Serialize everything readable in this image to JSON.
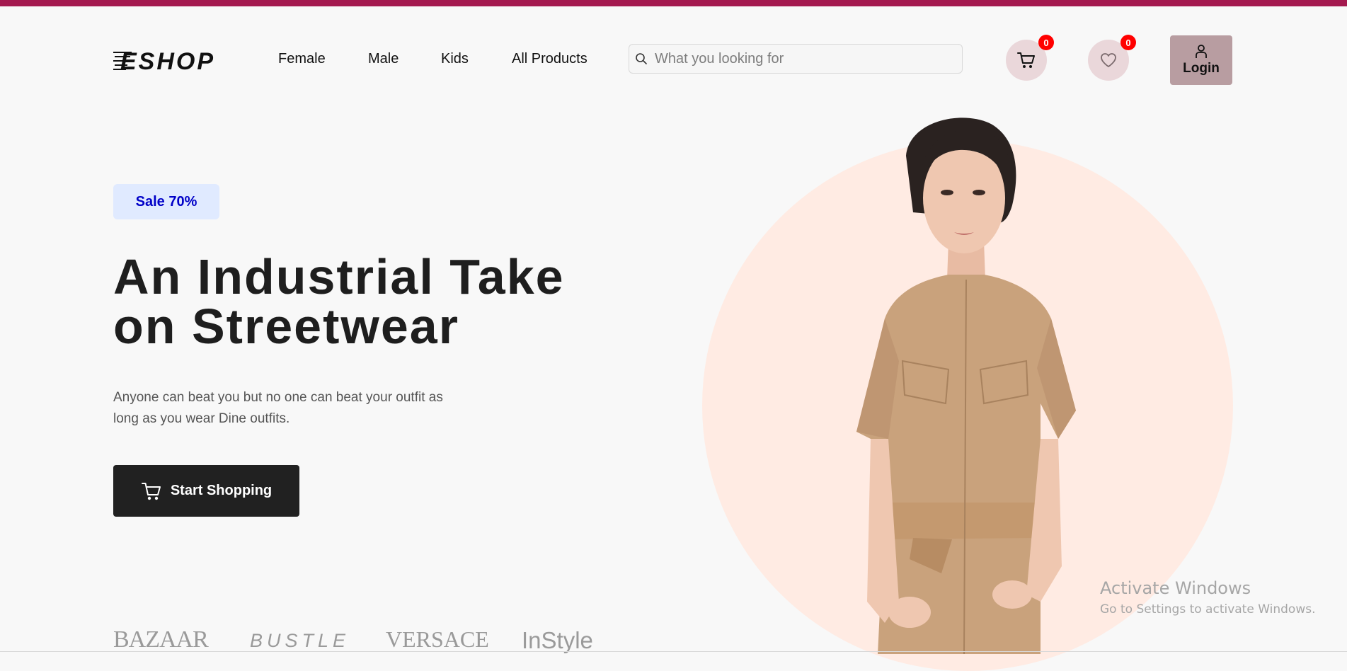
{
  "header": {
    "logo_text": "ESHOP",
    "nav": [
      {
        "label": "Female"
      },
      {
        "label": "Male"
      },
      {
        "label": "Kids"
      },
      {
        "label": "All Products"
      }
    ],
    "search_placeholder": "What you looking for",
    "cart_count": "0",
    "wishlist_count": "0",
    "login_label": "Login"
  },
  "hero": {
    "badge": "Sale 70%",
    "title_line1": "An Industrial Take",
    "title_line2": "on Streetwear",
    "desc_line1": "Anyone can beat you but no one can beat your outfit as",
    "desc_line2": "long as you wear Dine outfits.",
    "cta_label": "Start Shopping"
  },
  "brands": [
    "BAZAAR",
    "BUSTLE",
    "VERSACE",
    "InStyle"
  ],
  "watermark": {
    "title": "Activate Windows",
    "subtitle": "Go to Settings to activate Windows."
  },
  "colors": {
    "accent_strip": "#a4194f",
    "badge_bg": "#e0eaff",
    "badge_text": "#0000c8",
    "cta_bg": "#212121",
    "icon_button_bg": "#ead7da",
    "login_bg": "#b89da1",
    "hero_circle": "#ffebe3"
  },
  "icons": [
    "cart-icon",
    "heart-icon",
    "user-icon",
    "search-icon"
  ]
}
